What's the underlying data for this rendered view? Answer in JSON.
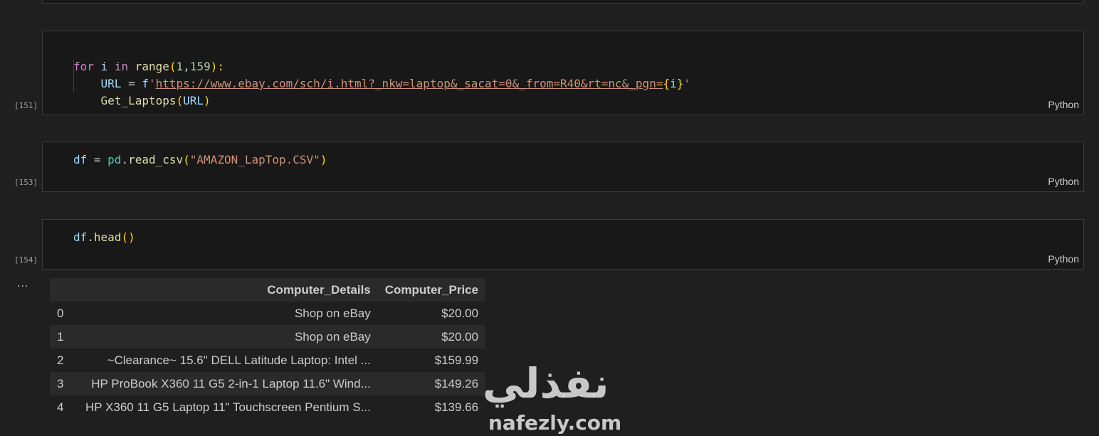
{
  "cells": [
    {
      "exec_count": "[151]",
      "language": "Python",
      "lines": [
        {
          "kw_for": "for",
          "var_i": "i",
          "kw_in": "in",
          "fn_range": "range",
          "open": "(",
          "n1": "1",
          "comma": ",",
          "n2": "159",
          "close": "):"
        },
        {
          "var_url": "URL",
          "eq": " = ",
          "prefix": "f",
          "q1": "'",
          "url": "https://www.ebay.com/sch/i.html?_nkw=laptop&_sacat=0&_from=R40&rt=nc&_pgn=",
          "lb": "{",
          "var": "i",
          "rb": "}",
          "q2": "'"
        },
        {
          "fn": "Get_Laptops",
          "open": "(",
          "arg": "URL",
          "close": ")"
        }
      ]
    },
    {
      "exec_count": "[153]",
      "language": "Python",
      "line": {
        "var": "df",
        "eq": " = ",
        "ns": "pd",
        "dot": ".",
        "fn": "read_csv",
        "open": "(",
        "str": "\"AMAZON_LapTop.CSV\"",
        "close": ")"
      }
    },
    {
      "exec_count": "[154]",
      "language": "Python",
      "line": {
        "var": "df",
        "dot": ".",
        "fn": "head",
        "parens": "()"
      }
    }
  ],
  "output": {
    "ellipsis": "...",
    "columns": [
      "",
      "Computer_Details",
      "Computer_Price"
    ],
    "rows": [
      {
        "index": "0",
        "details": "Shop on eBay",
        "price": "$20.00"
      },
      {
        "index": "1",
        "details": "Shop on eBay",
        "price": "$20.00"
      },
      {
        "index": "2",
        "details": "~Clearance~ 15.6\" DELL Latitude Laptop: Intel ...",
        "price": "$159.99"
      },
      {
        "index": "3",
        "details": "HP ProBook X360 11 G5 2-in-1 Laptop 11.6\" Wind...",
        "price": "$149.26"
      },
      {
        "index": "4",
        "details": "HP X360 11 G5 Laptop 11\" Touchscreen Pentium S...",
        "price": "$139.66"
      }
    ]
  },
  "watermark": {
    "arabic": "نفذلي",
    "latin": "nafezly.com"
  }
}
